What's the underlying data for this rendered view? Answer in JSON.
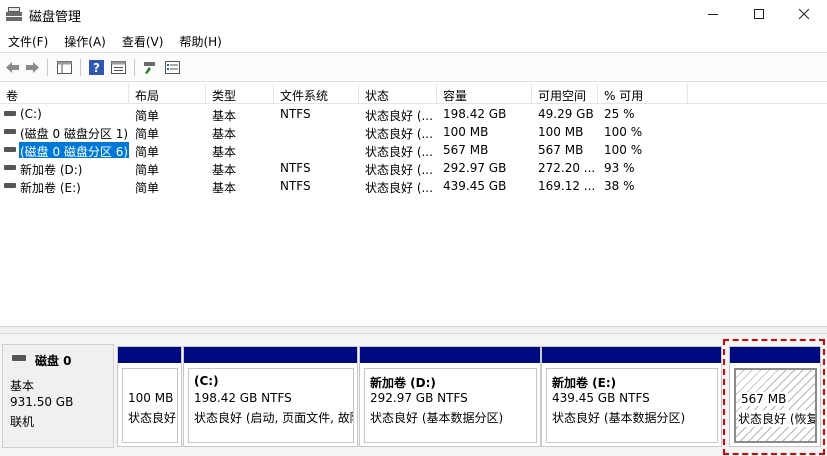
{
  "window": {
    "title": "磁盘管理",
    "minimize": "—",
    "maximize": "☐",
    "close": "✕"
  },
  "menu": [
    "文件(F)",
    "操作(A)",
    "查看(V)",
    "帮助(H)"
  ],
  "toolbar": {
    "buttons": [
      "back-icon",
      "forward-icon",
      "console-tree-icon",
      "help-icon",
      "properties-icon",
      "connect-icon",
      "list-view-icon"
    ]
  },
  "table": {
    "columns": [
      "卷",
      "布局",
      "类型",
      "文件系统",
      "状态",
      "容量",
      "可用空间",
      "% 可用"
    ],
    "rows": [
      {
        "name": "(C:)",
        "layout": "简单",
        "type": "基本",
        "fs": "NTFS",
        "status": "状态良好 (...",
        "capacity": "198.42 GB",
        "free": "49.29 GB",
        "pct": "25 %",
        "selected": false
      },
      {
        "name": "(磁盘 0 磁盘分区 1)",
        "layout": "简单",
        "type": "基本",
        "fs": "",
        "status": "状态良好 (...",
        "capacity": "100 MB",
        "free": "100 MB",
        "pct": "100 %",
        "selected": false
      },
      {
        "name": "(磁盘 0 磁盘分区 6)",
        "layout": "简单",
        "type": "基本",
        "fs": "",
        "status": "状态良好 (...",
        "capacity": "567 MB",
        "free": "567 MB",
        "pct": "100 %",
        "selected": true
      },
      {
        "name": "新加卷 (D:)",
        "layout": "简单",
        "type": "基本",
        "fs": "NTFS",
        "status": "状态良好 (...",
        "capacity": "292.97 GB",
        "free": "272.20 ...",
        "pct": "93 %",
        "selected": false
      },
      {
        "name": "新加卷 (E:)",
        "layout": "简单",
        "type": "基本",
        "fs": "NTFS",
        "status": "状态良好 (...",
        "capacity": "439.45 GB",
        "free": "169.12 ...",
        "pct": "38 %",
        "selected": false
      }
    ]
  },
  "disk": {
    "title": "磁盘 0",
    "type": "基本",
    "size": "931.50 GB",
    "state": "联机"
  },
  "partitions": [
    {
      "name": "",
      "size": "100 MB",
      "status": "状态良好"
    },
    {
      "name": "(C:)",
      "size": "198.42 GB NTFS",
      "status": "状态良好 (启动, 页面文件, 故障"
    },
    {
      "name": "新加卷 (D:)",
      "size": "292.97 GB NTFS",
      "status": "状态良好 (基本数据分区)"
    },
    {
      "name": "新加卷 (E:)",
      "size": "439.45 GB NTFS",
      "status": "状态良好 (基本数据分区)"
    },
    {
      "name": "",
      "size": "567 MB",
      "status": "状态良好 (恢复分"
    }
  ],
  "colors": {
    "partition_header": "#000a80",
    "selection": "#0078d7",
    "highlight_frame": "#e00000"
  }
}
